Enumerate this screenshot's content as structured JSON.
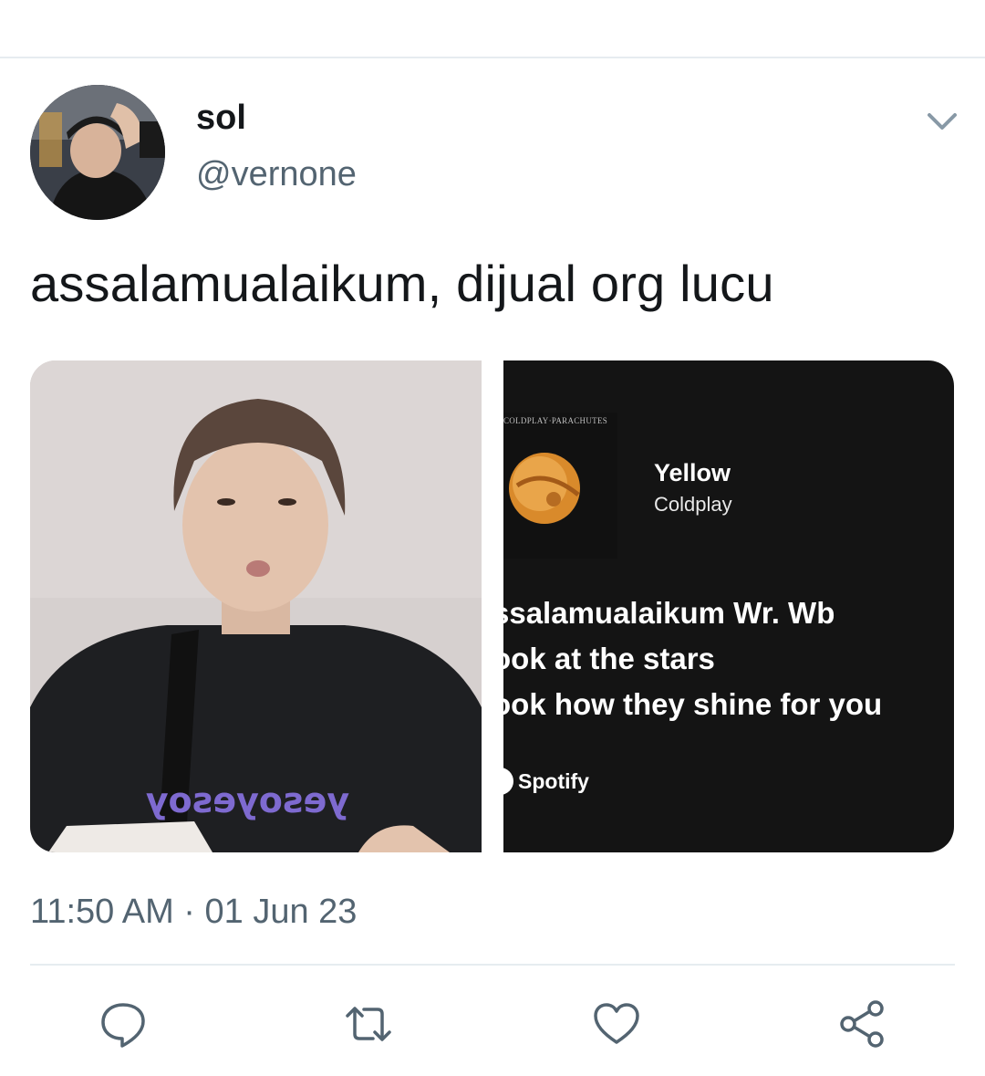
{
  "tweet": {
    "author_name": "sol",
    "author_handle": "@vernone",
    "text": "assalamualaikum, dijual org lucu",
    "timestamp": "11:50 AM · 01 Jun 23"
  },
  "spotify_card": {
    "album_label": "COLDPLAY·PARACHUTES",
    "song_title": "Yellow",
    "artist": "Coldplay",
    "lyrics": [
      "ssalamualaikum Wr. Wb",
      "ook at the stars",
      "ook how they shine for you"
    ],
    "brand": "Spotify"
  },
  "photo": {
    "shirt_text": "yesoyesoy"
  },
  "icons": {
    "menu": "chevron-down-icon",
    "reply": "reply-icon",
    "retweet": "retweet-icon",
    "like": "heart-icon",
    "share": "share-icon"
  },
  "colors": {
    "secondary_text": "#536471",
    "icon": "#536471",
    "card_background": "#141414"
  }
}
